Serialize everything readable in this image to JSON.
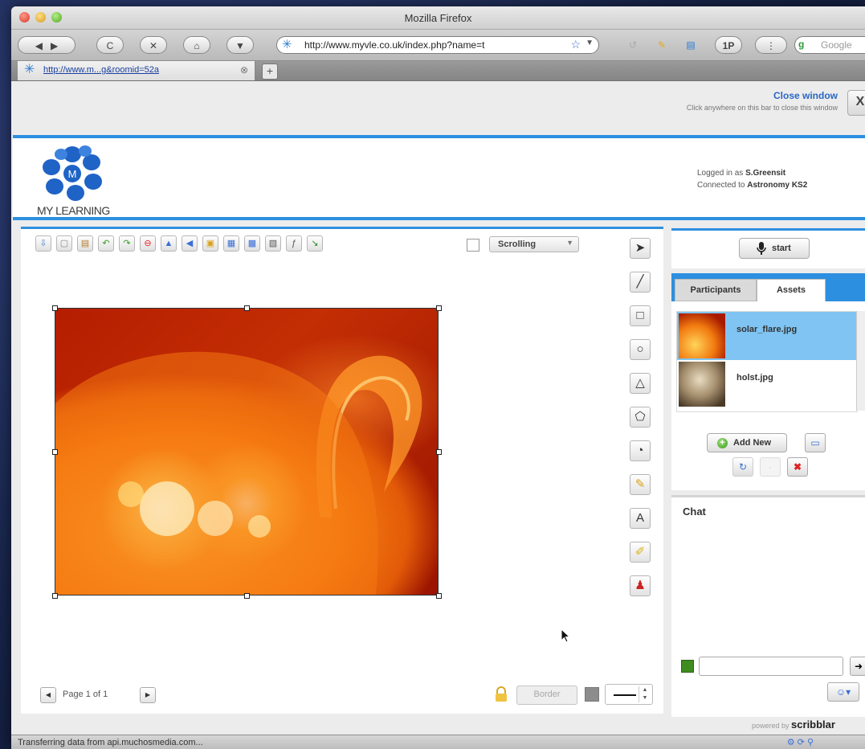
{
  "window": {
    "title": "Mozilla Firefox"
  },
  "nav": {
    "url": "http://www.myvle.co.uk/index.php?name=t",
    "search_placeholder": "Google",
    "onepassword_label": "1P"
  },
  "tabs": [
    {
      "label": "http://www.m...g&roomid=52a"
    }
  ],
  "closebar": {
    "title": "Close window",
    "hint": "Click anywhere on this bar to close this window",
    "close_glyph": "X"
  },
  "header": {
    "logo_text": "MY LEARNING",
    "logged_in_prefix": "Logged in as ",
    "logged_in_user": "S.Greensit",
    "connected_prefix": "Connected to ",
    "connected_room": "Astronomy KS2"
  },
  "whiteboard": {
    "scroll_mode": "Scrolling",
    "page_label": "Page 1 of 1",
    "border_label": "Border"
  },
  "right_panel": {
    "start_label": "start",
    "tabs": {
      "participants": "Participants",
      "assets": "Assets"
    },
    "assets": [
      {
        "name": "solar_flare.jpg",
        "selected": true
      },
      {
        "name": "holst.jpg",
        "selected": false
      }
    ],
    "add_new_label": "Add New",
    "chat_title": "Chat"
  },
  "powered_by": {
    "prefix": "powered by",
    "brand": "scribblar"
  },
  "status": {
    "text": "Transferring data from api.muchosmedia.com..."
  },
  "colors": {
    "accent_blue": "#2d8fe0",
    "selected_row": "#7fc4f2",
    "chat_swatch": "#3f8c20"
  }
}
